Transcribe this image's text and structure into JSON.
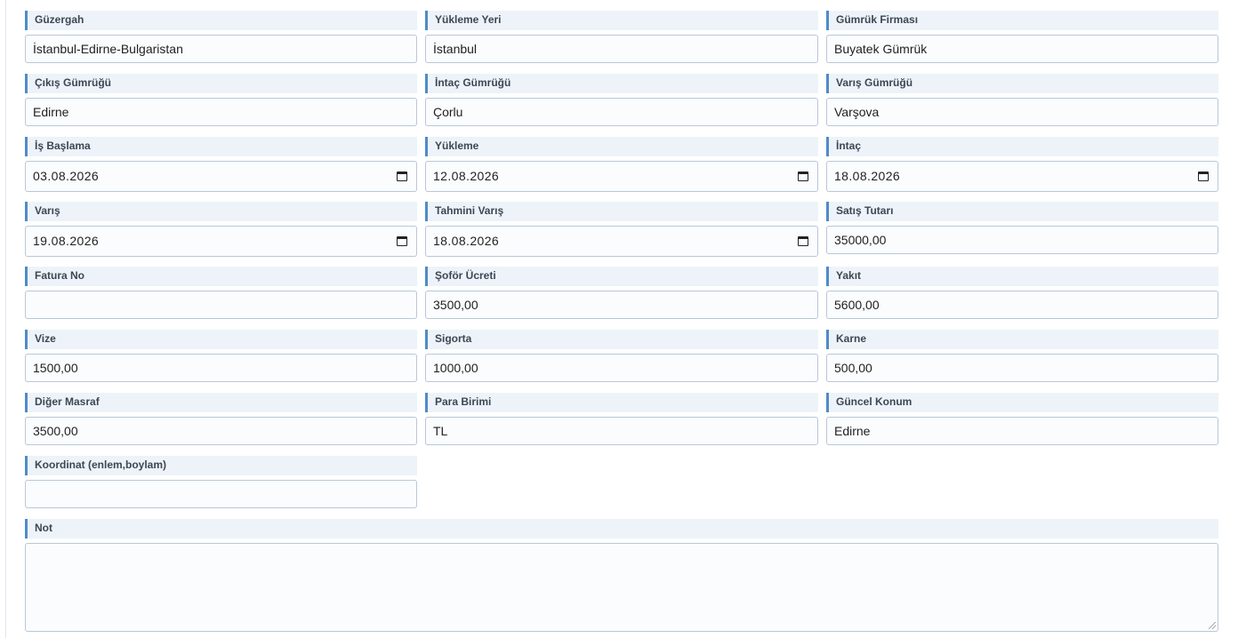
{
  "form": {
    "guzergah": {
      "label": "Güzergah",
      "value": "İstanbul-Edirne-Bulgaristan"
    },
    "yukleme_yeri": {
      "label": "Yükleme Yeri",
      "value": "İstanbul"
    },
    "gumruk_firmasi": {
      "label": "Gümrük Firması",
      "value": "Buyatek Gümrük"
    },
    "cikis_gumrugu": {
      "label": "Çıkış Gümrüğü",
      "value": "Edirne"
    },
    "intac_gumrugu": {
      "label": "İntaç Gümrüğü",
      "value": "Çorlu"
    },
    "varis_gumrugu": {
      "label": "Varış Gümrüğü",
      "value": "Varşova"
    },
    "is_baslama": {
      "label": "İş Başlama",
      "value": "03.08.2026"
    },
    "yukleme": {
      "label": "Yükleme",
      "value": "12.08.2026"
    },
    "intac": {
      "label": "İntaç",
      "value": "18.08.2026"
    },
    "varis": {
      "label": "Varış",
      "value": "19.08.2026"
    },
    "tahmini_varis": {
      "label": "Tahmini Varış",
      "value": "18.08.2026"
    },
    "satis_tutari": {
      "label": "Satış Tutarı",
      "value": "35000,00"
    },
    "fatura_no": {
      "label": "Fatura No",
      "value": ""
    },
    "sofor_ucreti": {
      "label": "Şoför Ücreti",
      "value": "3500,00"
    },
    "yakit": {
      "label": "Yakıt",
      "value": "5600,00"
    },
    "vize": {
      "label": "Vize",
      "value": "1500,00"
    },
    "sigorta": {
      "label": "Sigorta",
      "value": "1000,00"
    },
    "karne": {
      "label": "Karne",
      "value": "500,00"
    },
    "diger_masraf": {
      "label": "Diğer Masraf",
      "value": "3500,00"
    },
    "para_birimi": {
      "label": "Para Birimi",
      "value": "TL"
    },
    "guncel_konum": {
      "label": "Güncel Konum",
      "value": "Edirne"
    },
    "koordinat": {
      "label": "Koordinat (enlem,boylam)",
      "value": ""
    },
    "not": {
      "label": "Not",
      "value": ""
    }
  },
  "icons": {
    "date_picker": "calendar-icon",
    "resize": "resize-grip-icon"
  },
  "colors": {
    "label_bg": "#edf3f9",
    "label_accent": "#4f8bc9",
    "input_border": "#b9c7d6"
  }
}
